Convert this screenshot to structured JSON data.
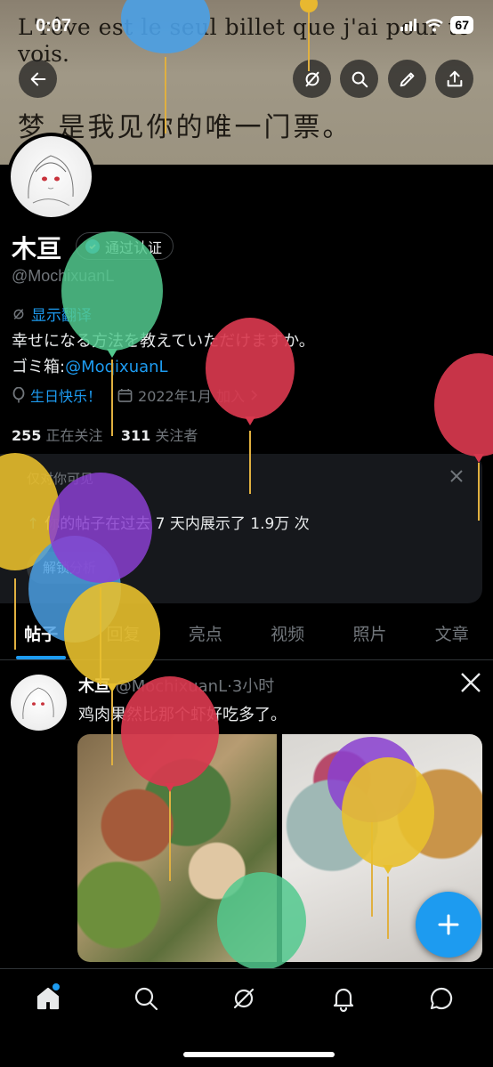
{
  "status_bar": {
    "time": "0:07",
    "battery": "67"
  },
  "banner": {
    "line1": "L'rêve est le seul billet que j'ai pour te",
    "line2": "vois.",
    "line3": "梦 是我见你的唯一门票。"
  },
  "profile": {
    "name": "木亘",
    "verified_label": "通过认证",
    "handle": "@MochixuanL",
    "translate_label": "显示翻译",
    "bio_line1": "幸せになる方法を教えていただけますか。",
    "bio_line2_prefix": "ゴミ箱:",
    "bio_line2_link": "@MoqixuanL",
    "birthday": "生日快乐！",
    "joined": "2022年1月 加入",
    "following_count": "255",
    "following_label": "正在关注",
    "followers_count": "311",
    "followers_label": "关注者"
  },
  "insight_card": {
    "title": "仅对你可见",
    "text": "你的帖子在过去 7 天内展示了 1.9万 次",
    "button": "解锁分析"
  },
  "tabs": [
    "帖子",
    "回复",
    "亮点",
    "视频",
    "照片",
    "文章"
  ],
  "post": {
    "name": "木亘",
    "handle": "@MochixuanL",
    "time": "3小时",
    "separator": "·",
    "text": "鸡肉果然比那个虾好吃多了。"
  },
  "icons": {
    "back": "back-arrow-icon",
    "grok": "grok-icon",
    "search": "search-icon",
    "edit": "edit-pencil-icon",
    "share": "share-icon",
    "home": "home-icon",
    "explore": "search-icon",
    "notifications": "bell-icon",
    "messages": "chat-bubble-icon",
    "compose": "plus-icon"
  },
  "colors": {
    "accent": "#1d9bf0",
    "background": "#000000",
    "muted": "#71767b"
  }
}
